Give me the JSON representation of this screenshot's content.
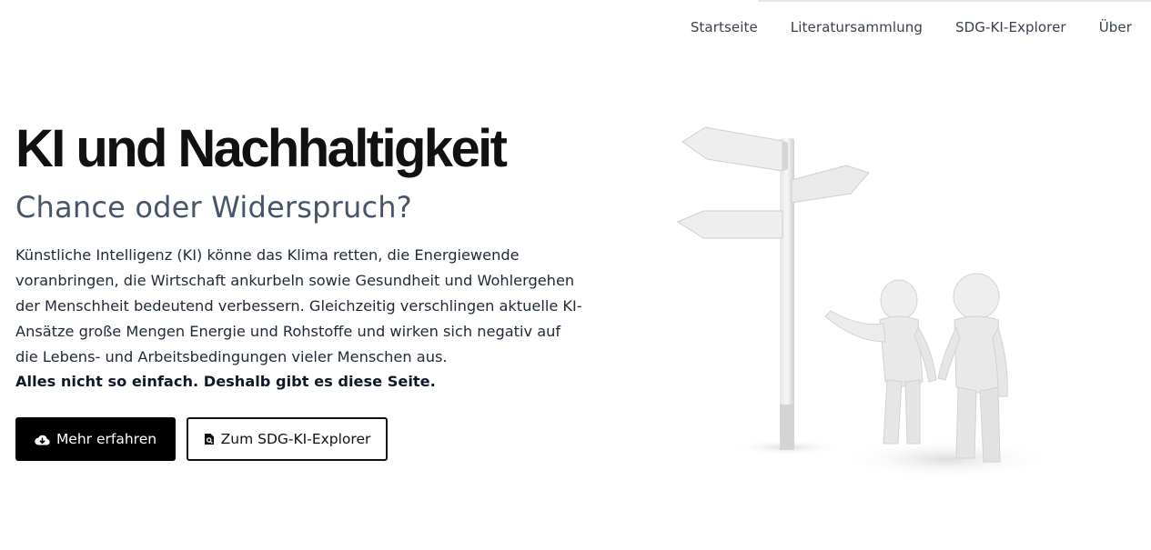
{
  "nav": {
    "items": [
      {
        "label": "Startseite"
      },
      {
        "label": "Literatursammlung"
      },
      {
        "label": "SDG-KI-Explorer"
      },
      {
        "label": "Über"
      }
    ]
  },
  "hero": {
    "title": "KI und Nachhaltigkeit",
    "subtitle": "Chance oder Widerspruch?",
    "paragraph": "Künstliche Intelligenz (KI) könne das Klima retten, die Energiewende voranbringen, die Wirtschaft ankurbeln sowie Gesundheit und Wohlergehen der Menschheit bedeutend verbessern. Gleichzeitig verschlingen aktuelle KI-Ansätze große Mengen Energie und Rohstoffe und wirken sich negativ auf die Lebens- und Arbeitsbedingungen vieler Menschen aus.",
    "emphasis": "Alles nicht so einfach. Deshalb gibt es diese Seite.",
    "primary_button": {
      "label": "Mehr erfahren",
      "icon": "cloud-download-icon"
    },
    "secondary_button": {
      "label": "Zum SDG-KI-Explorer",
      "icon": "file-search-icon"
    }
  },
  "colors": {
    "primary_button_bg": "#000000",
    "subtitle": "#475569",
    "nav_text": "#374151"
  }
}
